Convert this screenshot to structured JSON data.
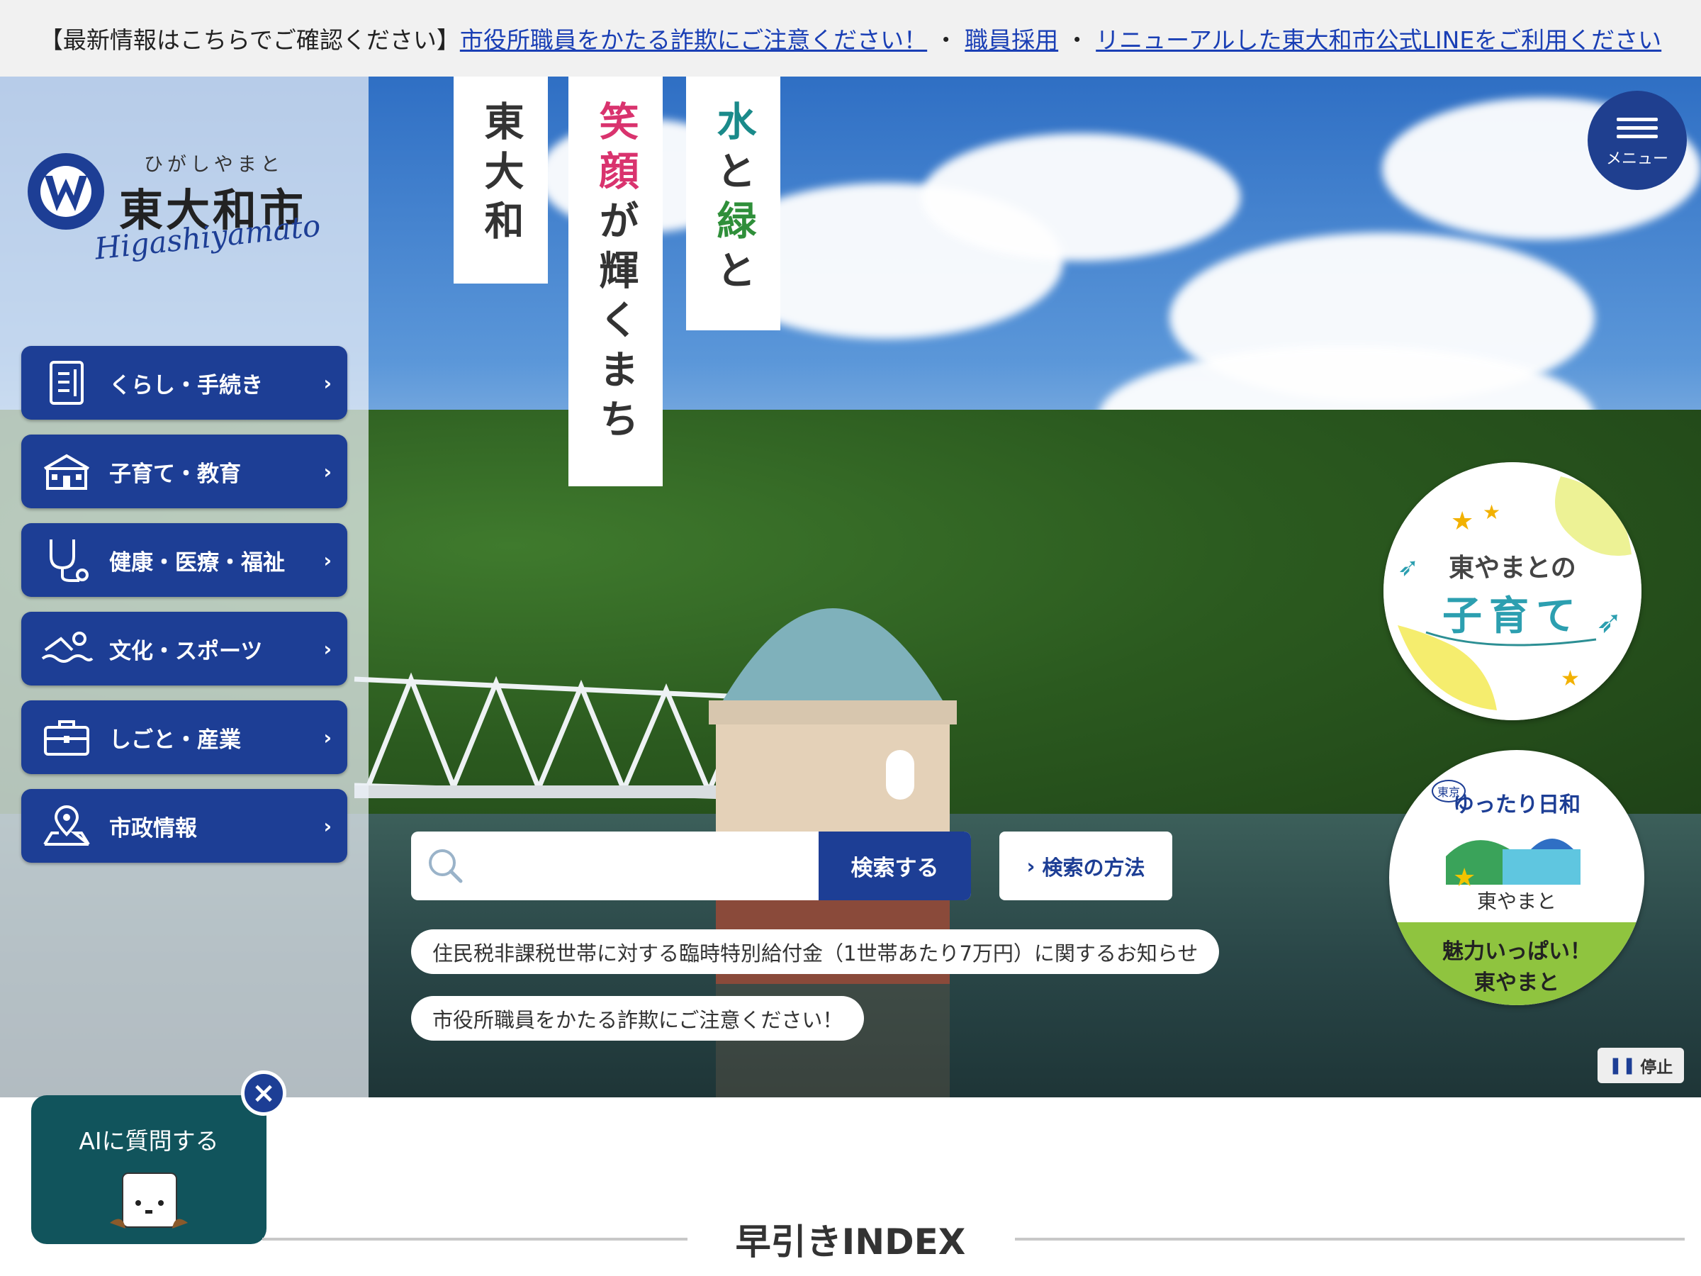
{
  "topbar": {
    "prefix": "【最新情報はこちらでご確認ください】",
    "links": [
      "市役所職員をかたる詐欺にご注意ください！",
      "職員採用",
      "リニューアルした東大和市公式LINEをご利用ください"
    ],
    "separator": "・"
  },
  "logo": {
    "kana": "ひがしやまと",
    "name": "東大和市",
    "romaji": "Higashiyamato"
  },
  "nav": [
    {
      "label": "くらし・手続き",
      "icon": "document-icon"
    },
    {
      "label": "子育て・教育",
      "icon": "school-icon"
    },
    {
      "label": "健康・医療・福祉",
      "icon": "stethoscope-icon"
    },
    {
      "label": "文化・スポーツ",
      "icon": "swimmer-icon"
    },
    {
      "label": "しごと・産業",
      "icon": "briefcase-icon"
    },
    {
      "label": "市政情報",
      "icon": "map-pin-icon"
    }
  ],
  "slogan": {
    "col1": "東大和",
    "col2_a": "笑顔",
    "col2_b": "が輝くまち",
    "col3_a": "水",
    "col3_b": "と",
    "col3_c": "緑",
    "col3_d": "と"
  },
  "menu": {
    "label": "メニュー"
  },
  "badges": {
    "kosodate": {
      "line1": "東やまとの",
      "line2": "子育て"
    },
    "yuttari": {
      "small": "東京",
      "line1": "ゆったり日和",
      "line2": "東やまと",
      "line3": "魅力いっぱい！",
      "line4": "東やまと"
    }
  },
  "search": {
    "placeholder": "",
    "button": "検索する",
    "how": "検索の方法"
  },
  "notices": [
    "住民税非課税世帯に対する臨時特別給付金（1世帯あたり7万円）に関するお知らせ",
    "市役所職員をかたる詐欺にご注意ください！"
  ],
  "pause": {
    "label": "停止"
  },
  "ai": {
    "label": "AIに質問する"
  },
  "index": {
    "title": "早引きINDEX"
  },
  "colors": {
    "primary": "#1d3e95",
    "ai": "#11545c",
    "link": "#1a3fb5",
    "pink": "#d9336e",
    "teal": "#1a8a8a",
    "green": "#2f8f3a"
  }
}
